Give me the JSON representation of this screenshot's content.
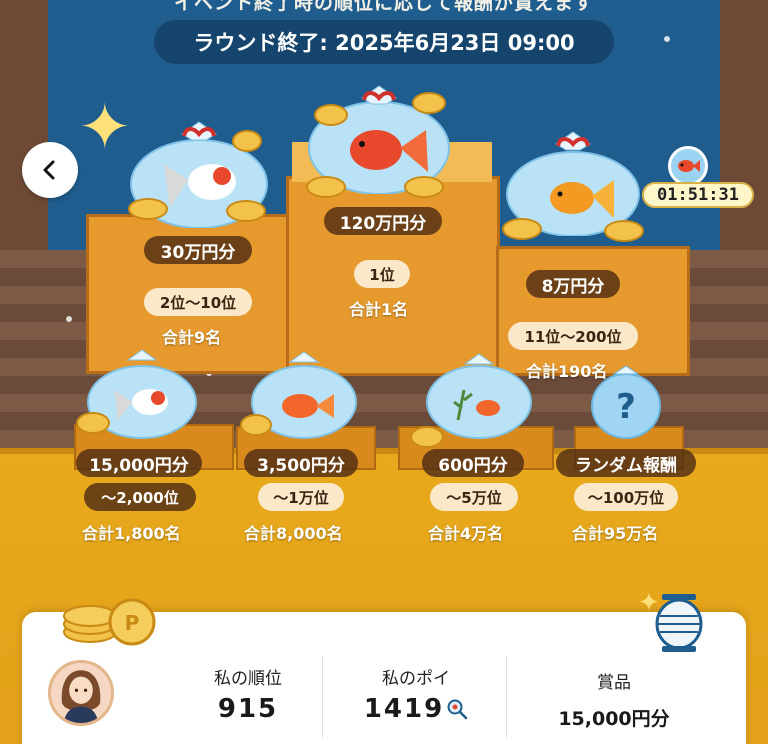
{
  "header": {
    "notice": "イベント終了時の順位に応じて報酬が貰えます",
    "round_end": "ラウンド終了: 2025年6月23日 09:00"
  },
  "timer": {
    "value": "01:51:31"
  },
  "prizes": [
    {
      "amount": "120万円分",
      "rank": "1位",
      "total": "合計1名",
      "fish": "ranchu"
    },
    {
      "amount": "30万円分",
      "rank": "2位〜10位",
      "total": "合計9名",
      "fish": "white-red"
    },
    {
      "amount": "8万円分",
      "rank": "11位〜200位",
      "total": "合計190名",
      "fish": "orange"
    },
    {
      "amount": "15,000円分",
      "rank": "〜2,000位",
      "total": "合計1,800名",
      "fish": "white-red"
    },
    {
      "amount": "3,500円分",
      "rank": "〜1万位",
      "total": "合計8,000名",
      "fish": "orange"
    },
    {
      "amount": "600円分",
      "rank": "〜5万位",
      "total": "合計4万名",
      "fish": "small-orange"
    },
    {
      "amount": "ランダム報酬",
      "rank": "〜100万位",
      "total": "合計95万名",
      "fish": "question"
    }
  ],
  "my_stats": {
    "rank_label": "私の順位",
    "rank_value": "915",
    "poi_label": "私のポイ",
    "poi_value": "1419",
    "prize_label": "賞品",
    "prize_value": "15,000円分"
  },
  "icons": [
    "back-icon",
    "goldfish-icon",
    "magnifier-icon",
    "lantern-icon",
    "coin-icon"
  ],
  "colors": {
    "floor": "#e8a91c",
    "curtain": "#1f5d8f",
    "pill_dark": "#50301a",
    "pill_light": "#fbe8c8"
  }
}
